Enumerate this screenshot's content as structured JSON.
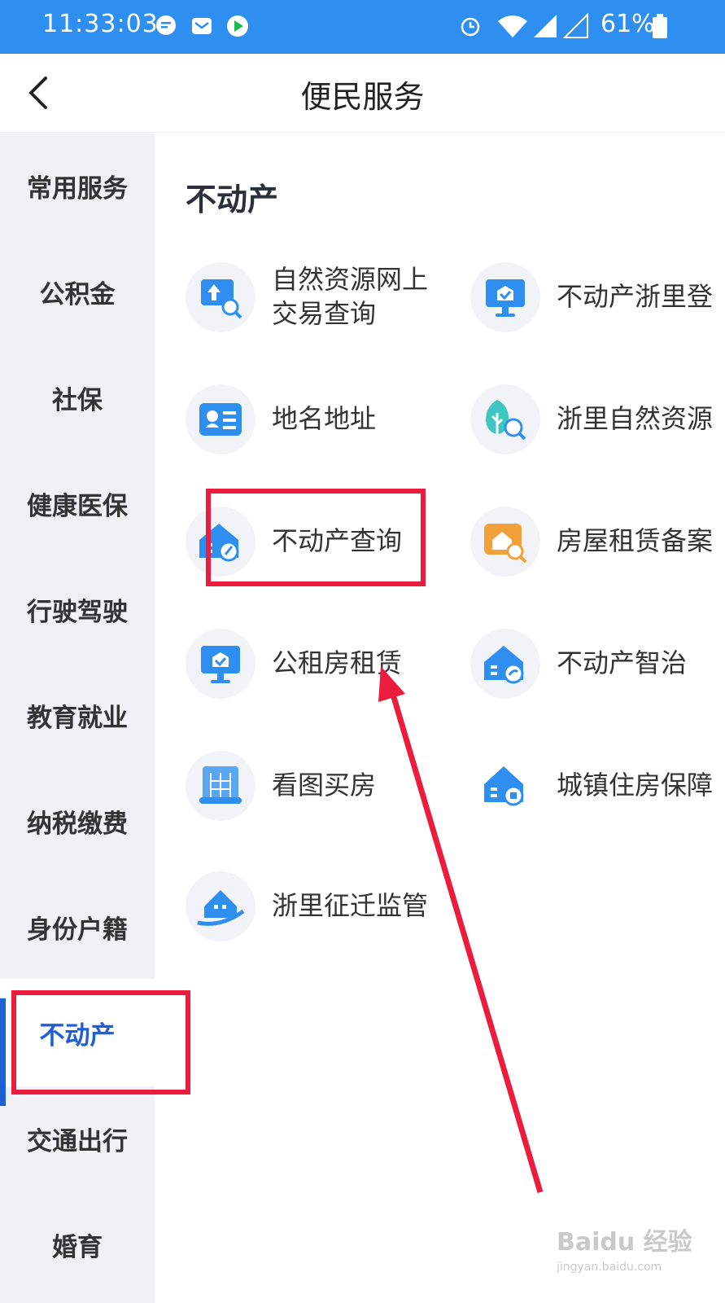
{
  "status_bar": {
    "time": "11:33:03",
    "battery": "61%",
    "icons": [
      "message-icon",
      "mail-icon",
      "play-icon",
      "alarm-icon",
      "wifi-icon",
      "signal-icon",
      "signal2-icon",
      "battery-icon"
    ]
  },
  "header": {
    "title": "便民服务",
    "back_icon": "chevron-left-icon"
  },
  "sidebar": {
    "items": [
      {
        "label": "常用服务"
      },
      {
        "label": "公积金"
      },
      {
        "label": "社保"
      },
      {
        "label": "健康医保"
      },
      {
        "label": "行驶驾驶"
      },
      {
        "label": "教育就业"
      },
      {
        "label": "纳税缴费"
      },
      {
        "label": "身份户籍"
      },
      {
        "label": "不动产"
      },
      {
        "label": "交通出行"
      },
      {
        "label": "婚育"
      }
    ],
    "active": "不动产",
    "active_color": "#1e5ed6"
  },
  "main": {
    "section_title": "不动产",
    "services": [
      {
        "label": "自然资源网上\n交易查询",
        "icon": "tree-search-icon"
      },
      {
        "label": "不动产浙里登",
        "icon": "monitor-check-icon"
      },
      {
        "label": "地名地址",
        "icon": "id-card-icon"
      },
      {
        "label": "浙里自然资源",
        "icon": "nature-search-icon"
      },
      {
        "label": "不动产查询",
        "icon": "house-compass-icon"
      },
      {
        "label": "房屋租赁备案",
        "icon": "house-search-icon"
      },
      {
        "label": "公租房租赁",
        "icon": "monitor-check-icon"
      },
      {
        "label": "不动产智治",
        "icon": "house-link-icon"
      },
      {
        "label": "看图买房",
        "icon": "blueprint-icon"
      },
      {
        "label": "城镇住房保障",
        "icon": "house-shield-icon"
      },
      {
        "label": "浙里征迁监管",
        "icon": "house-swoosh-icon"
      }
    ]
  },
  "annotation_color": "#ec1c3f",
  "watermark": {
    "brand": "Baidu 经验",
    "url": "jingyan.baidu.com"
  }
}
